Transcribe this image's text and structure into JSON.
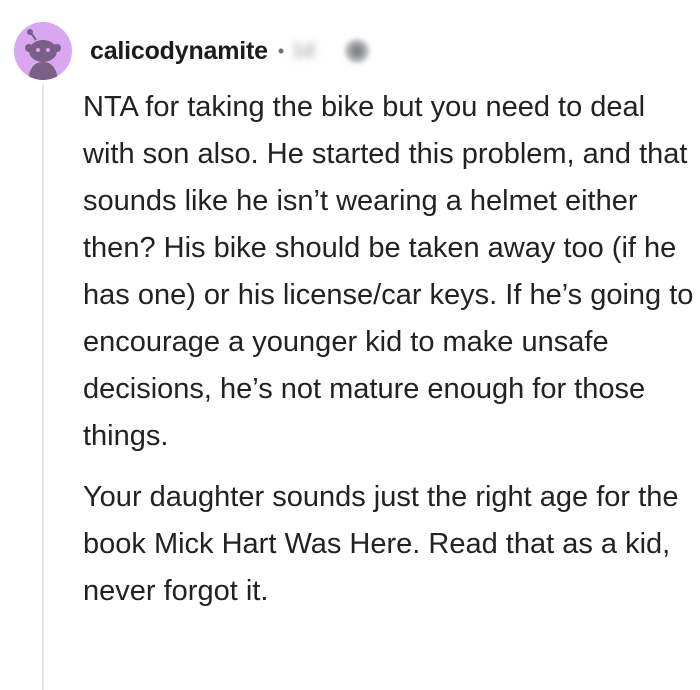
{
  "comment": {
    "username": "calicodynamite",
    "separator": "•",
    "timestamp": "1d",
    "paragraphs": [
      "NTA for taking the bike but you need to deal with son also. He started this problem, and that sounds like he isn’t wearing a helmet either then? His bike should be taken away too (if he has one) or his license/car keys. If he’s going to encourage a younger kid to make unsafe decisions, he’s not mature enough for those things.",
      "Your daughter sounds just the right age for the book Mick Hart Was Here. Read that as a kid, never forgot it."
    ]
  },
  "colors": {
    "avatar_bg": "#d9a7f0",
    "avatar_figure": "#7a5f86",
    "thread_line": "#e4e6e8",
    "text": "#222222",
    "meta": "#6b6f73"
  },
  "icons": {
    "avatar": "reddit-snoo-avatar-icon",
    "blurred": "blurred-award-icon"
  }
}
